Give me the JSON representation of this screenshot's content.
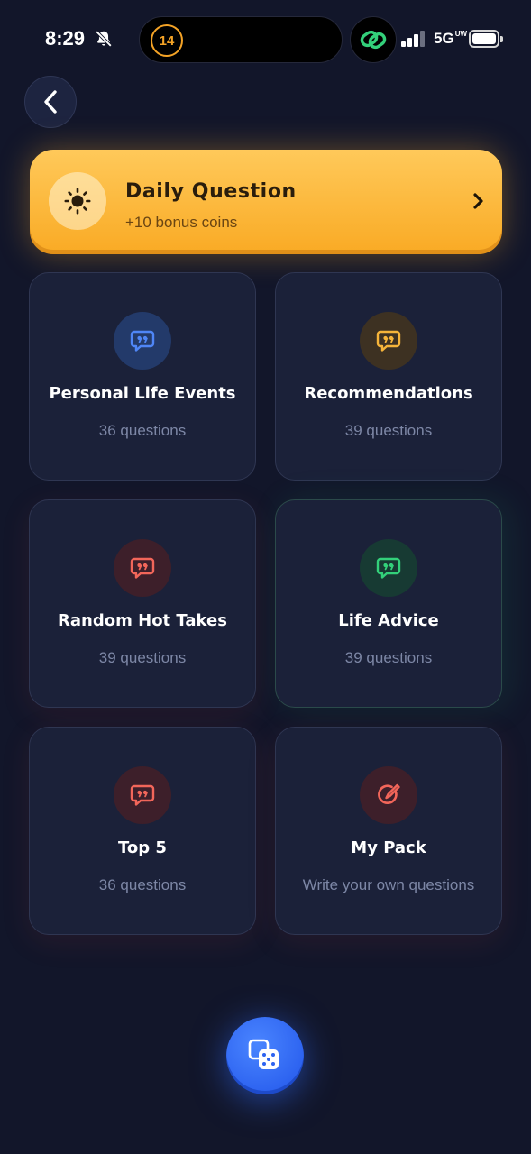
{
  "status_bar": {
    "time": "8:29",
    "island_badge": "14",
    "network": "5G",
    "network_suffix": "UW"
  },
  "back_button": {
    "icon": "chevron-left-icon"
  },
  "daily": {
    "title": "Daily Question",
    "subtitle": "+10 bonus coins",
    "icon": "sun-icon",
    "accent": "#f9aa24"
  },
  "categories": [
    {
      "title": "Personal Life Events",
      "subtitle": "36 questions",
      "icon": "quote-bubble-icon",
      "color": "#4f86f7",
      "bg": "#233a6a"
    },
    {
      "title": "Recommendations",
      "subtitle": "39 questions",
      "icon": "quote-bubble-icon",
      "color": "#f6b43a",
      "bg": "#3d3122"
    },
    {
      "title": "Random Hot Takes",
      "subtitle": "39 questions",
      "icon": "quote-bubble-icon",
      "color": "#f2665a",
      "bg": "#3d1f2a"
    },
    {
      "title": "Life Advice",
      "subtitle": "39 questions",
      "icon": "quote-bubble-icon",
      "color": "#33d07a",
      "bg": "#173a33"
    },
    {
      "title": "Top 5",
      "subtitle": "36 questions",
      "icon": "quote-bubble-icon",
      "color": "#f2665a",
      "bg": "#3d1f2a"
    },
    {
      "title": "My Pack",
      "subtitle": "Write your own questions",
      "icon": "edit-pencil-icon",
      "color": "#f2665a",
      "bg": "#3d1f2a"
    }
  ],
  "fab": {
    "icon": "dice-icon",
    "color": "#2d63f0"
  }
}
